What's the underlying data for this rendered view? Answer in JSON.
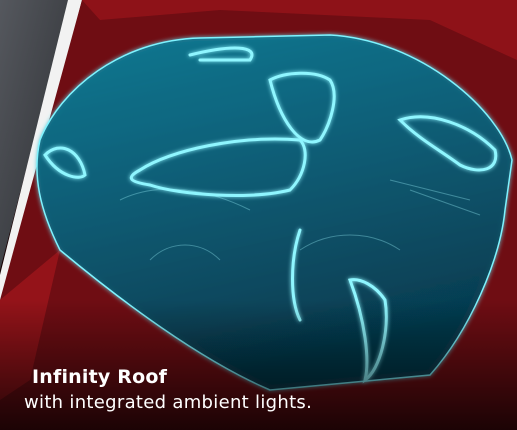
{
  "caption": {
    "title": "Infinity Roof",
    "subtitle": "with integrated ambient lights."
  },
  "image": {
    "subject": "car-roof-icon",
    "colors": {
      "background": "#1a0608",
      "car_body": "#8a1218",
      "glass": "#0f6f86",
      "ambient_light": "#7ff3ff",
      "panel_gray": "#3a3d42",
      "stripe": "#f2f2f2"
    }
  }
}
